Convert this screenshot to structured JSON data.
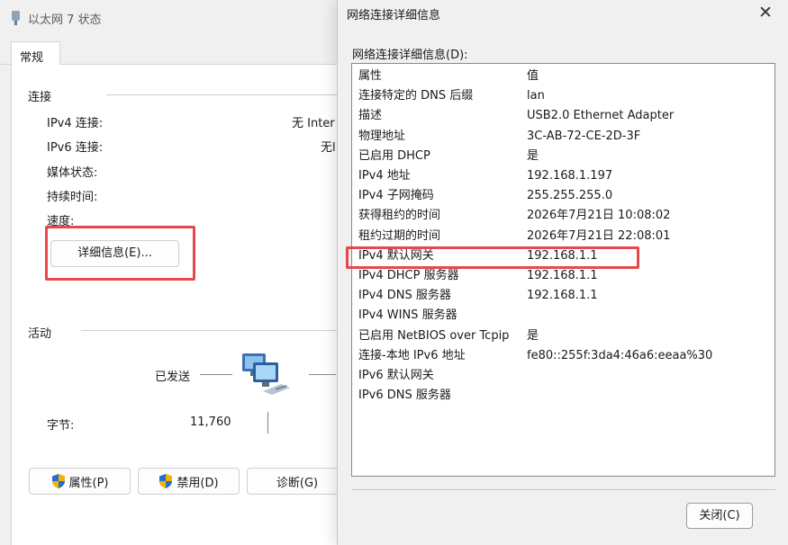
{
  "status_window": {
    "title": "以太网 7 状态",
    "tab_general": "常规",
    "connection": {
      "group_label": "连接",
      "ipv4_label": "IPv4 连接:",
      "ipv4_value": "无 Inter",
      "ipv6_label": "IPv6 连接:",
      "ipv6_value": "无l",
      "media_label": "媒体状态:",
      "duration_label": "持续时间:",
      "speed_label": "速度:"
    },
    "details_button": "详细信息(E)...",
    "activity": {
      "group_label": "活动",
      "sent_label": "已发送",
      "bytes_label": "字节:",
      "bytes_sent": "11,760"
    },
    "buttons": {
      "properties": "属性(P)",
      "disable": "禁用(D)",
      "diagnose": "诊断(G)"
    }
  },
  "details_window": {
    "title": "网络连接详细信息",
    "list_caption": "网络连接详细信息(D):",
    "header": {
      "property": "属性",
      "value": "值"
    },
    "rows": [
      {
        "property": "连接特定的 DNS 后缀",
        "value": "lan"
      },
      {
        "property": "描述",
        "value": "USB2.0 Ethernet Adapter"
      },
      {
        "property": "物理地址",
        "value": "3C-AB-72-CE-2D-3F"
      },
      {
        "property": "已启用 DHCP",
        "value": "是"
      },
      {
        "property": "IPv4 地址",
        "value": "192.168.1.197"
      },
      {
        "property": "IPv4 子网掩码",
        "value": "255.255.255.0"
      },
      {
        "property": "获得租约的时间",
        "value": "2026年7月21日 10:08:02"
      },
      {
        "property": "租约过期的时间",
        "value": "2026年7月21日 22:08:01"
      },
      {
        "property": "IPv4 默认网关",
        "value": "192.168.1.1"
      },
      {
        "property": "IPv4 DHCP 服务器",
        "value": "192.168.1.1"
      },
      {
        "property": "IPv4 DNS 服务器",
        "value": "192.168.1.1"
      },
      {
        "property": "IPv4 WINS 服务器",
        "value": ""
      },
      {
        "property": "已启用 NetBIOS over Tcpip",
        "value": "是"
      },
      {
        "property": "连接-本地 IPv6 地址",
        "value": "fe80::255f:3da4:46a6:eeaa%30"
      },
      {
        "property": "IPv6 默认网关",
        "value": ""
      },
      {
        "property": "IPv6 DNS 服务器",
        "value": ""
      }
    ],
    "close_button": "关闭(C)"
  },
  "colors": {
    "highlight": "#e8474b",
    "window_bg": "#f0f0f0",
    "panel_bg": "#ffffff"
  },
  "icons": [
    "network-adapter-icon",
    "network-computers-icon",
    "uac-shield-icon",
    "close-icon"
  ]
}
